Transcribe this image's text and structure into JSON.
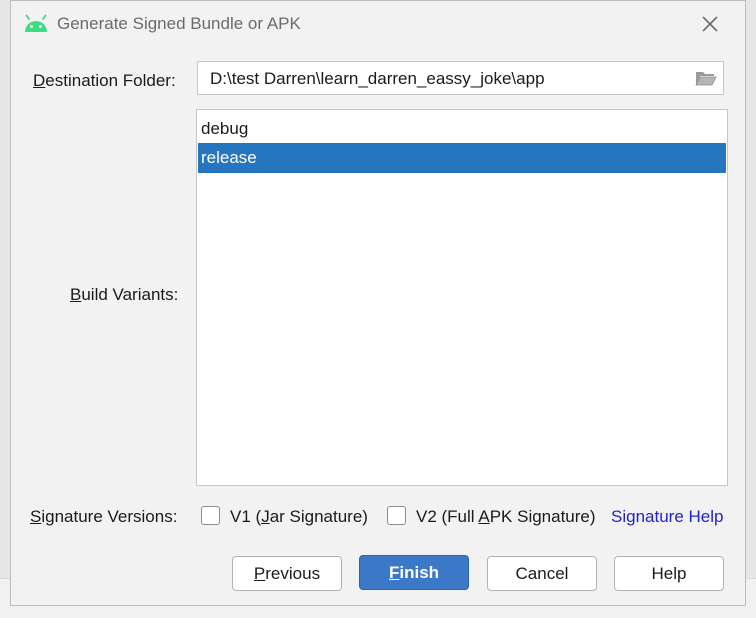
{
  "window": {
    "title": "Generate Signed Bundle or APK",
    "icon": "android-icon",
    "close_icon": "close-icon"
  },
  "destination": {
    "label_mnemonic": "D",
    "label_rest": "estination Folder:",
    "value": "D:\\test Darren\\learn_darren_eassy_joke\\app",
    "browse_icon": "folder-open-icon"
  },
  "build_variants": {
    "label_mnemonic": "B",
    "label_rest": "uild Variants:",
    "items": [
      {
        "label": "debug",
        "selected": false
      },
      {
        "label": "release",
        "selected": true
      }
    ]
  },
  "signature": {
    "label_mnemonic": "S",
    "label_rest": "ignature Versions:",
    "v1_pre": "V1 (",
    "v1_mnemonic": "J",
    "v1_post": "ar Signature)",
    "v1_checked": false,
    "v2_pre": "V2 (Full ",
    "v2_mnemonic": "A",
    "v2_post": "PK Signature)",
    "v2_checked": false,
    "help_link": "Signature Help"
  },
  "buttons": {
    "previous_mnemonic": "P",
    "previous_rest": "revious",
    "finish_mnemonic": "F",
    "finish_rest": "inish",
    "cancel": "Cancel",
    "help": "Help"
  },
  "colors": {
    "selection": "#2675bf",
    "primary_button": "#3b79c8",
    "link": "#2222cc",
    "android_green": "#3ddc84"
  }
}
